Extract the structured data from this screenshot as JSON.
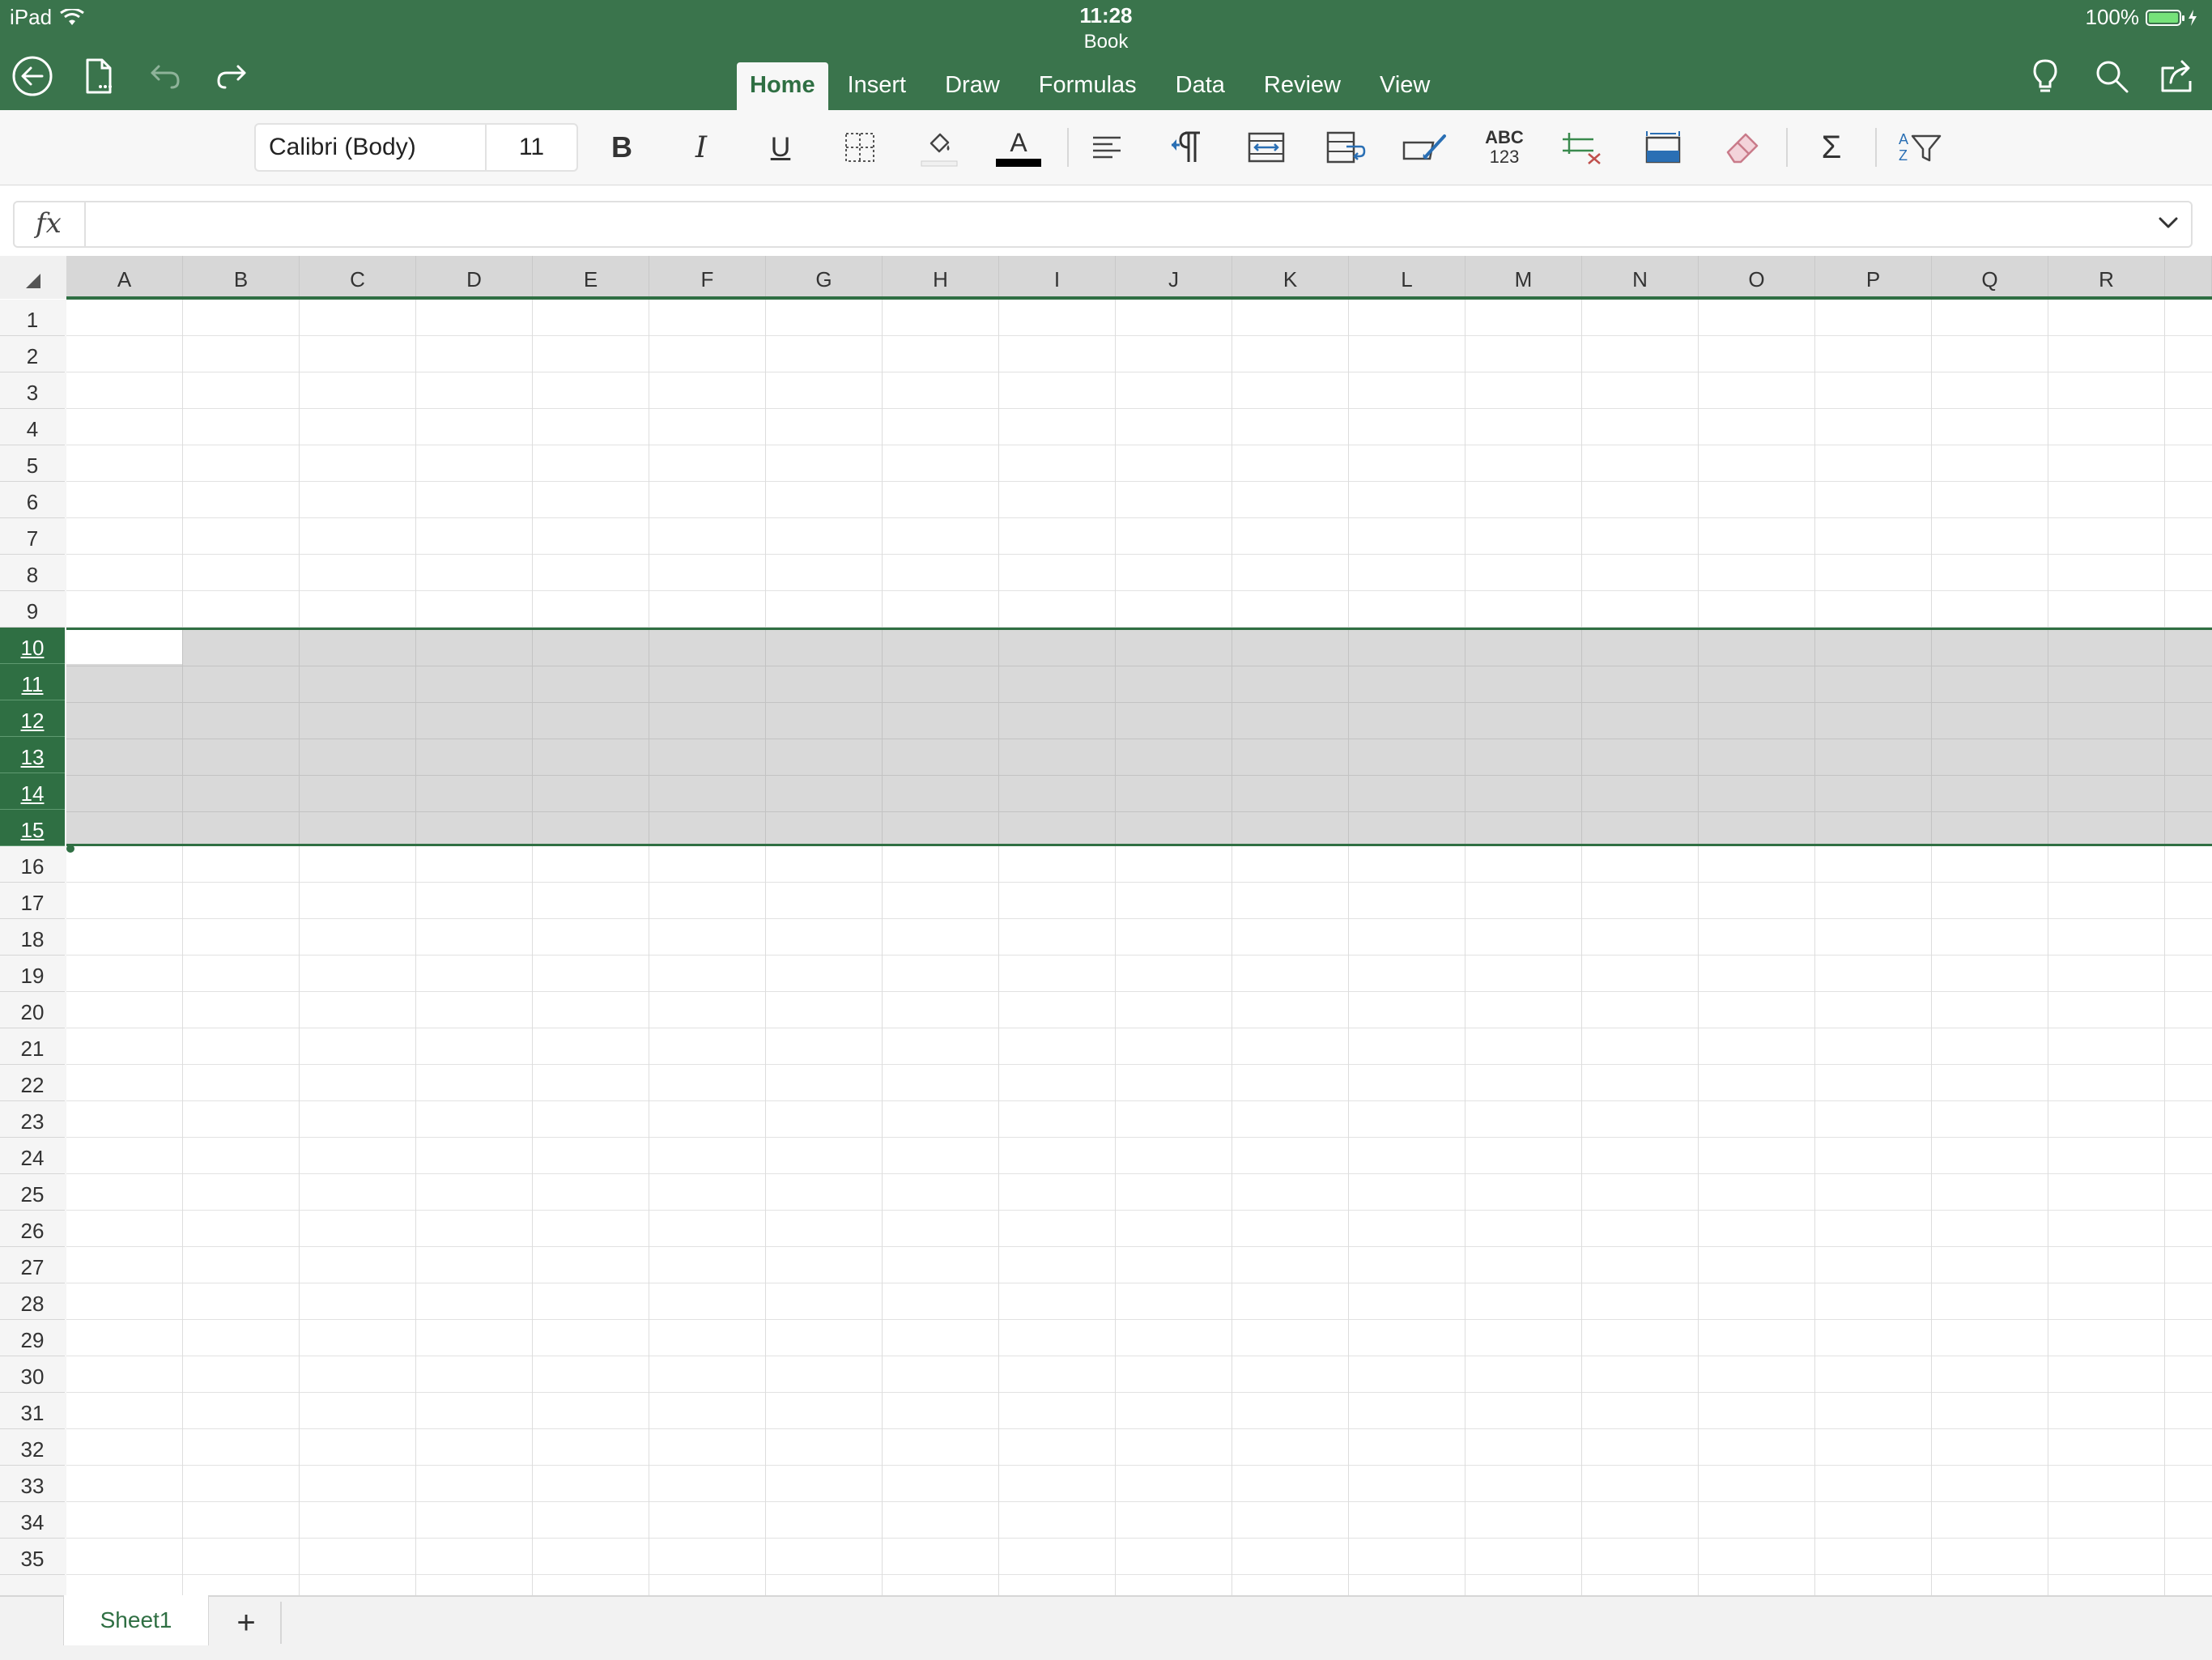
{
  "status_bar": {
    "device": "iPad",
    "time": "11:28",
    "battery": "100%",
    "battery_level": 1.0
  },
  "document": {
    "title": "Book"
  },
  "ribbon_tabs": [
    {
      "label": "Home",
      "active": true
    },
    {
      "label": "Insert"
    },
    {
      "label": "Draw"
    },
    {
      "label": "Formulas"
    },
    {
      "label": "Data"
    },
    {
      "label": "Review"
    },
    {
      "label": "View"
    }
  ],
  "ribbon": {
    "font_name": "Calibri (Body)",
    "font_size": "11",
    "bold_label": "B",
    "italic_label": "I",
    "underline_label": "U",
    "font_color_label": "A",
    "number_format_label_top": "ABC",
    "number_format_label_bottom": "123",
    "autosum_label": "Σ",
    "sort_label_top": "A",
    "sort_label_bottom": "Z"
  },
  "formula_bar": {
    "label": "fx",
    "value": ""
  },
  "grid": {
    "columns": [
      "A",
      "B",
      "C",
      "D",
      "E",
      "F",
      "G",
      "H",
      "I",
      "J",
      "K",
      "L",
      "M",
      "N",
      "O",
      "P",
      "Q",
      "R"
    ],
    "rows": [
      "1",
      "2",
      "3",
      "4",
      "5",
      "6",
      "7",
      "8",
      "9",
      "10",
      "11",
      "12",
      "13",
      "14",
      "15",
      "16",
      "17",
      "18",
      "19",
      "20",
      "21",
      "22",
      "23",
      "24",
      "25",
      "26",
      "27",
      "28",
      "29",
      "30",
      "31",
      "32",
      "33",
      "34",
      "35"
    ],
    "selected_rows": [
      "10",
      "11",
      "12",
      "13",
      "14",
      "15"
    ],
    "active_cell": "A10"
  },
  "sheets": [
    {
      "label": "Sheet1",
      "active": true
    }
  ],
  "add_sheet_label": "+",
  "colors": {
    "header_green": "#3a744c",
    "accent_green": "#2f6f43",
    "selection_gray": "#d9d9d9"
  }
}
